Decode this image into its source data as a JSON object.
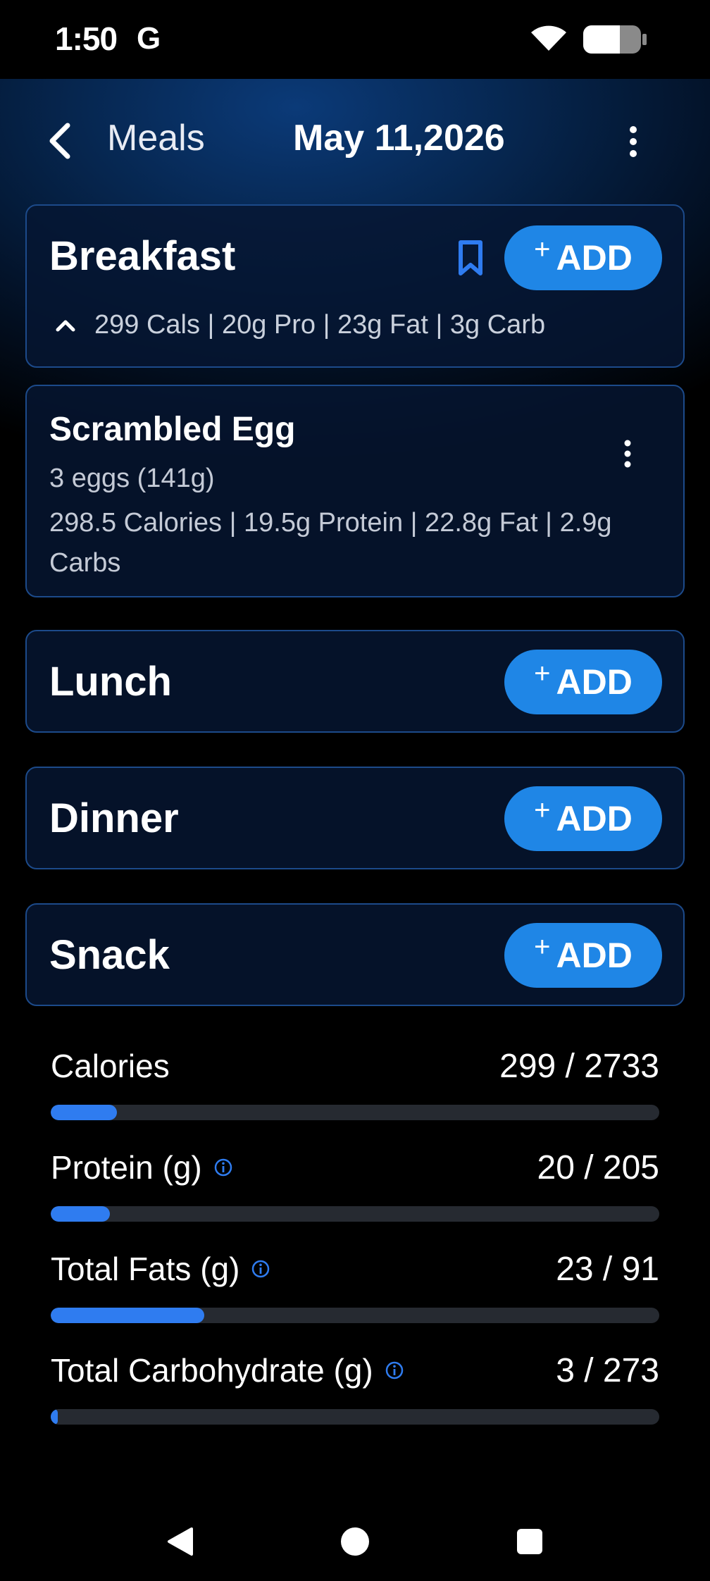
{
  "status_bar": {
    "time": "1:50",
    "carrier": "G"
  },
  "header": {
    "back_label": "Meals",
    "date": "May 11,2026"
  },
  "meals": {
    "breakfast": {
      "title": "Breakfast",
      "add_label": "ADD",
      "summary": "299 Cals | 20g Pro | 23g Fat | 3g Carb",
      "items": [
        {
          "name": "Scrambled Egg",
          "serving": "3 eggs (141g)",
          "macros": "298.5 Calories  |  19.5g Protein  |  22.8g Fat  |  2.9g Carbs"
        }
      ]
    },
    "lunch": {
      "title": "Lunch",
      "add_label": "ADD"
    },
    "dinner": {
      "title": "Dinner",
      "add_label": "ADD"
    },
    "snack": {
      "title": "Snack",
      "add_label": "ADD"
    }
  },
  "add_plus": "+",
  "nutrition": [
    {
      "label": "Calories",
      "value": "299 / 2733",
      "progress": 0.109,
      "info": false
    },
    {
      "label": "Protein (g)",
      "value": "20 / 205",
      "progress": 0.0976,
      "info": true
    },
    {
      "label": "Total Fats (g)",
      "value": "23 / 91",
      "progress": 0.2527,
      "info": true
    },
    {
      "label": "Total Carbohydrate (g)",
      "value": "3 / 273",
      "progress": 0.011,
      "info": true
    }
  ],
  "icons": {
    "back": "chevron-left-icon",
    "more": "vertical-dots-icon",
    "bookmark": "bookmark-icon",
    "collapse": "chevron-up-icon",
    "info": "info-icon"
  },
  "colors": {
    "accent": "#1f86e6",
    "progress": "#2f7cf0",
    "card_border": "#1c4a8a"
  }
}
